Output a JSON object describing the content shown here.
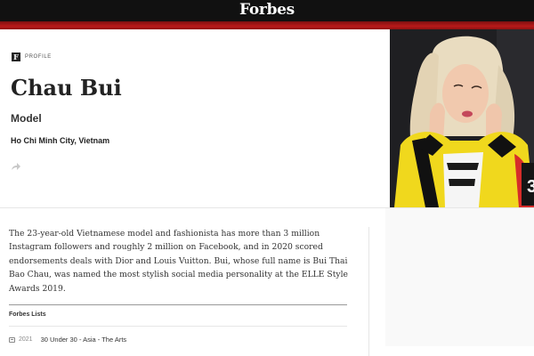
{
  "header": {
    "logo": "Forbes"
  },
  "profile": {
    "badge_letter": "F",
    "badge_label": "PROFILE",
    "name": "Chau Bui",
    "role": "Model",
    "location": "Ho Chi Minh City, Vietnam",
    "photo_overlay_text": "3"
  },
  "bio": {
    "text": "The 23-year-old Vietnamese model and fashionista has more than 3 million Instagram followers and roughly 2 million on Facebook, and in 2020 scored endorsements deals with Dior and Louis Vuitton. Bui, whose full name is Bui Thai Bao Chau, was named the most stylish social media personality at the ELLE Style Awards 2019."
  },
  "lists": {
    "title": "Forbes Lists",
    "items": [
      {
        "year": "2021",
        "label": "30 Under 30 - Asia - The Arts"
      }
    ]
  },
  "icons": {
    "share": "share-icon",
    "list": "list-calendar-icon"
  },
  "colors": {
    "topbar": "#111111",
    "accent_red": "#b81a1a"
  }
}
